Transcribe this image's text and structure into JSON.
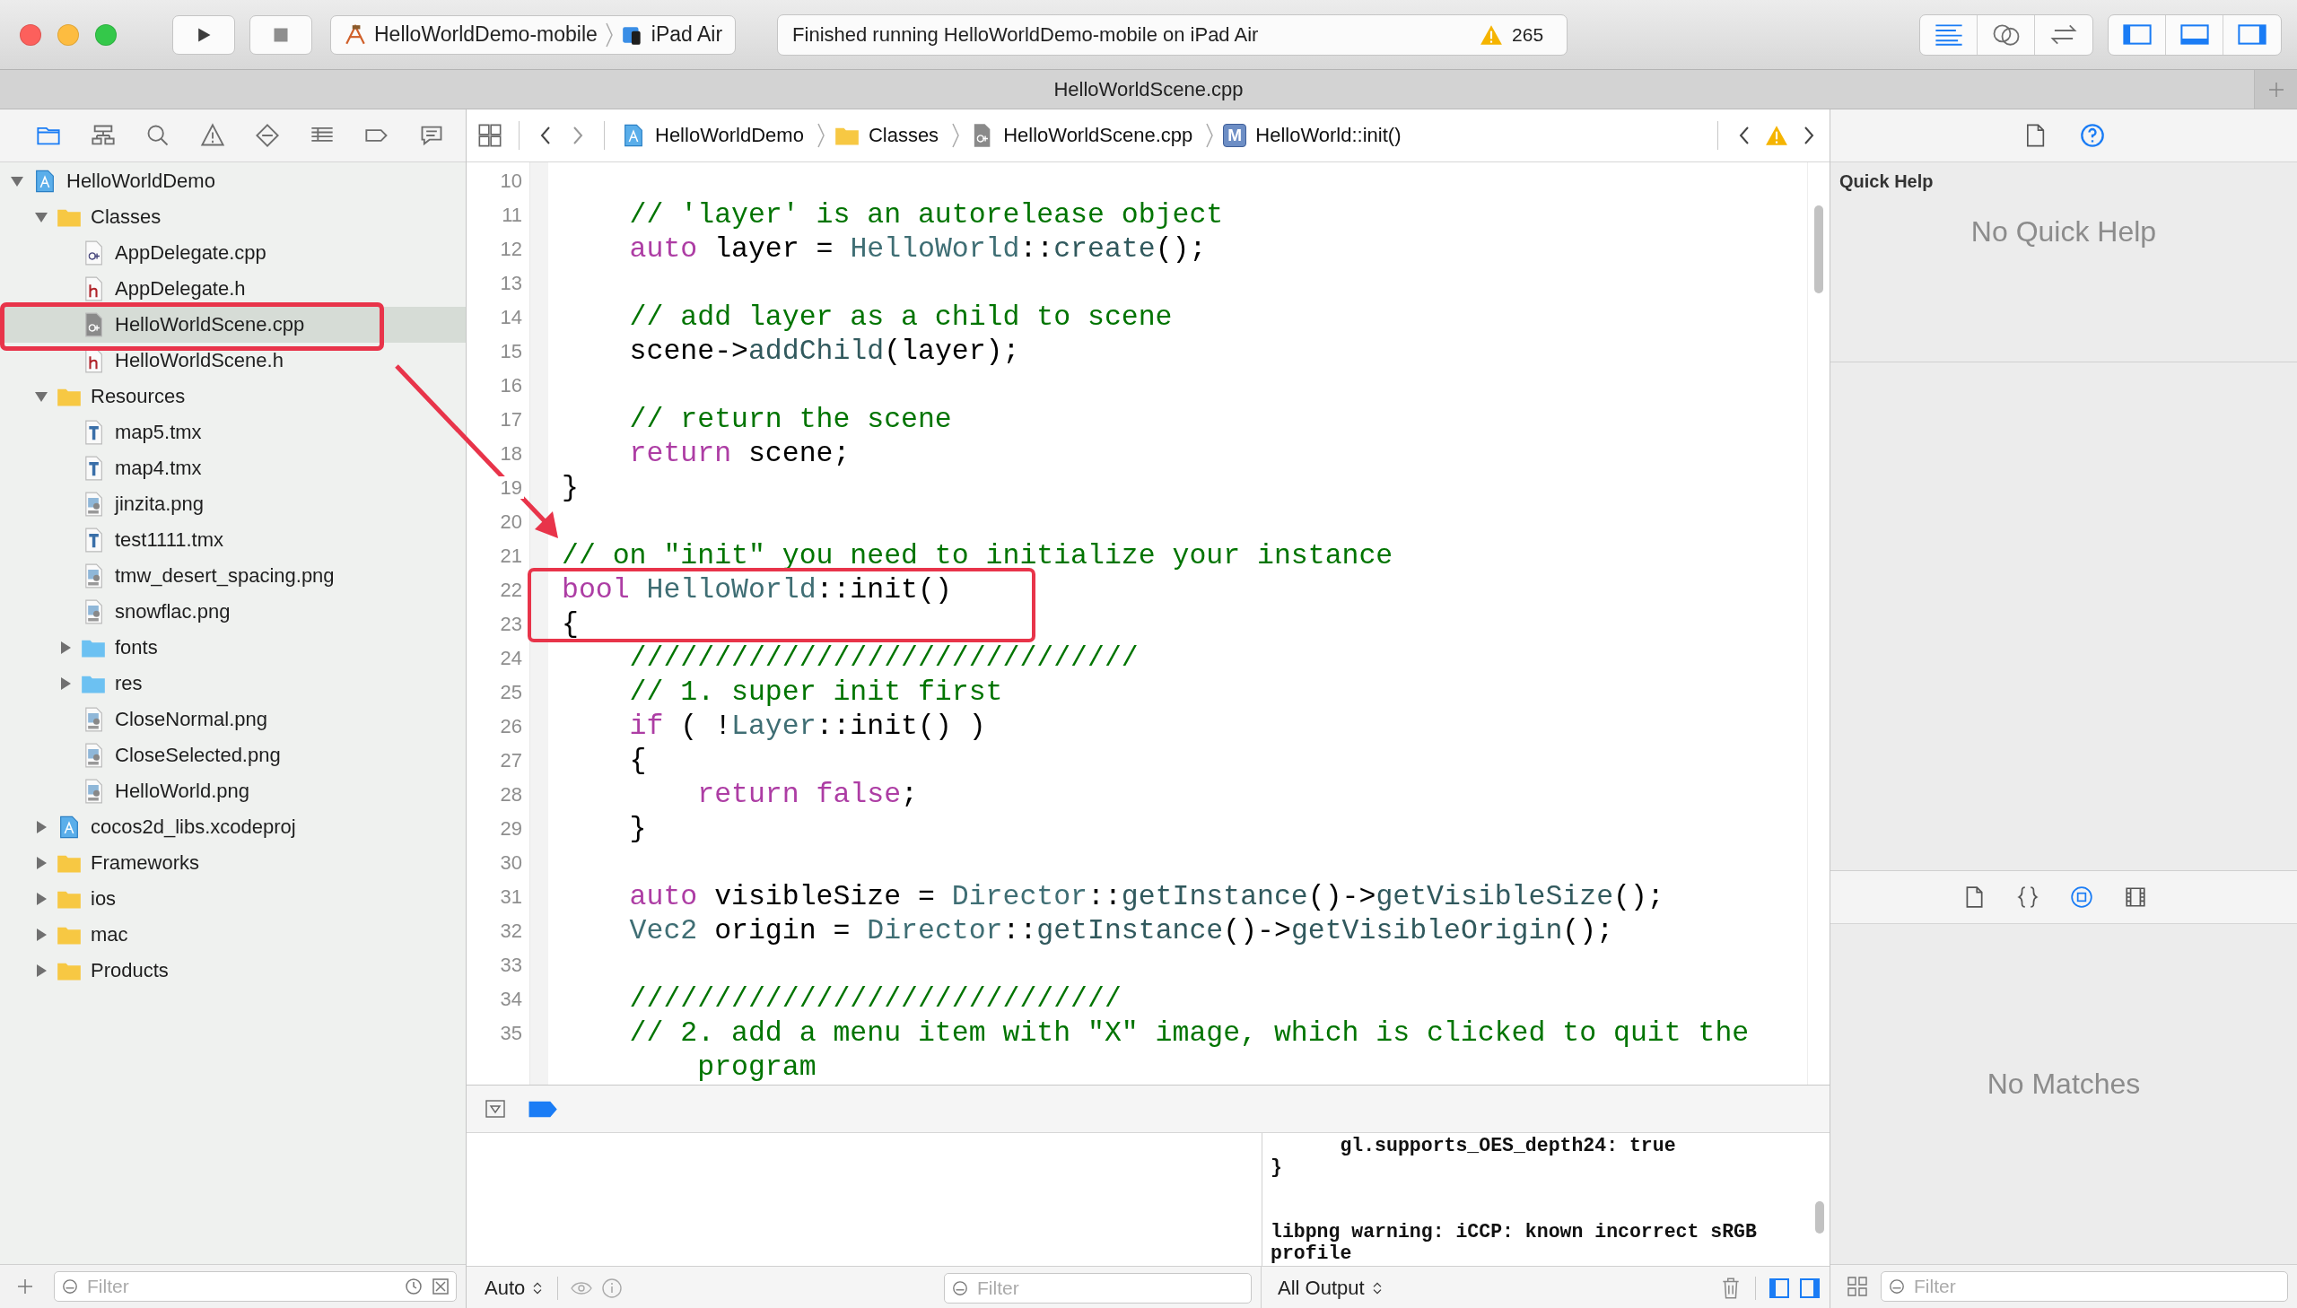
{
  "window": {
    "title": "HelloWorldScene.cpp"
  },
  "toolbar": {
    "scheme": "HelloWorldDemo-mobile",
    "device": "iPad Air",
    "status": "Finished running HelloWorldDemo-mobile on iPad Air",
    "warning_count": "265",
    "editor_modes": [
      {
        "kind": "standard",
        "selected": true
      },
      {
        "kind": "assistant",
        "selected": false
      },
      {
        "kind": "version",
        "selected": false
      }
    ],
    "panels": [
      {
        "kind": "navigator",
        "on": true
      },
      {
        "kind": "debug",
        "on": true
      },
      {
        "kind": "utilities",
        "on": true
      }
    ]
  },
  "navigator": {
    "tabs": [
      {
        "kind": "project",
        "selected": true
      },
      {
        "kind": "symbol",
        "selected": false
      },
      {
        "kind": "find",
        "selected": false
      },
      {
        "kind": "issue",
        "selected": false
      },
      {
        "kind": "test",
        "selected": false
      },
      {
        "kind": "debug",
        "selected": false
      },
      {
        "kind": "breakpoint",
        "selected": false
      },
      {
        "kind": "report",
        "selected": false
      }
    ],
    "tree": [
      {
        "name": "HelloWorldDemo",
        "kind": "project",
        "expanded": true,
        "selected": false,
        "children": [
          {
            "name": "Classes",
            "kind": "folder",
            "expanded": true,
            "selected": false,
            "children": [
              {
                "name": "AppDelegate.cpp",
                "kind": "cpp",
                "selected": false
              },
              {
                "name": "AppDelegate.h",
                "kind": "h",
                "selected": false
              },
              {
                "name": "HelloWorldScene.cpp",
                "kind": "cpp",
                "selected": true
              },
              {
                "name": "HelloWorldScene.h",
                "kind": "h",
                "selected": false
              }
            ]
          },
          {
            "name": "Resources",
            "kind": "folder",
            "expanded": true,
            "selected": false,
            "children": [
              {
                "name": "map5.tmx",
                "kind": "tmx",
                "selected": false
              },
              {
                "name": "map4.tmx",
                "kind": "tmx",
                "selected": false
              },
              {
                "name": "jinzita.png",
                "kind": "png",
                "selected": false
              },
              {
                "name": "test1111.tmx",
                "kind": "tmx",
                "selected": false
              },
              {
                "name": "tmw_desert_spacing.png",
                "kind": "png",
                "selected": false
              },
              {
                "name": "snowflac.png",
                "kind": "png",
                "selected": false
              },
              {
                "name": "fonts",
                "kind": "group",
                "expanded": false,
                "selected": false
              },
              {
                "name": "res",
                "kind": "group",
                "expanded": false,
                "selected": false
              },
              {
                "name": "CloseNormal.png",
                "kind": "png",
                "selected": false
              },
              {
                "name": "CloseSelected.png",
                "kind": "png",
                "selected": false
              },
              {
                "name": "HelloWorld.png",
                "kind": "png",
                "selected": false
              }
            ]
          },
          {
            "name": "cocos2d_libs.xcodeproj",
            "kind": "project",
            "expanded": false,
            "selected": false
          },
          {
            "name": "Frameworks",
            "kind": "folder",
            "expanded": false,
            "selected": false
          },
          {
            "name": "ios",
            "kind": "folder",
            "expanded": false,
            "selected": false
          },
          {
            "name": "mac",
            "kind": "folder",
            "expanded": false,
            "selected": false
          },
          {
            "name": "Products",
            "kind": "folder",
            "expanded": false,
            "selected": false
          }
        ]
      }
    ],
    "filter": {
      "placeholder": "Filter"
    }
  },
  "jump_bar": {
    "crumbs": [
      {
        "kind": "project",
        "label": "HelloWorldDemo"
      },
      {
        "kind": "folder",
        "label": "Classes"
      },
      {
        "kind": "cpp",
        "label": "HelloWorldScene.cpp"
      },
      {
        "kind": "method",
        "badge": "M",
        "label": "HelloWorld::init()"
      }
    ]
  },
  "editor": {
    "lines": [
      {
        "number": "10"
      },
      {
        "number": "11",
        "tokens": [
          {
            "kind": "comment",
            "text": "    // 'layer' is an autorelease object"
          }
        ]
      },
      {
        "number": "12",
        "tokens": [
          {
            "kind": "keyword",
            "text": "    auto"
          },
          {
            "kind": "plain",
            "text": " layer = "
          },
          {
            "kind": "type",
            "text": "HelloWorld"
          },
          {
            "kind": "plain",
            "text": "::"
          },
          {
            "kind": "function",
            "text": "create"
          },
          {
            "kind": "plain",
            "text": "();"
          }
        ]
      },
      {
        "number": "13"
      },
      {
        "number": "14",
        "tokens": [
          {
            "kind": "comment",
            "text": "    // add layer as a child to scene"
          }
        ]
      },
      {
        "number": "15",
        "tokens": [
          {
            "kind": "plain",
            "text": "    scene->"
          },
          {
            "kind": "function",
            "text": "addChild"
          },
          {
            "kind": "plain",
            "text": "(layer);"
          }
        ]
      },
      {
        "number": "16"
      },
      {
        "number": "17",
        "tokens": [
          {
            "kind": "comment",
            "text": "    // return the scene"
          }
        ]
      },
      {
        "number": "18",
        "tokens": [
          {
            "kind": "keyword",
            "text": "    return"
          },
          {
            "kind": "plain",
            "text": " scene;"
          }
        ]
      },
      {
        "number": "19",
        "tokens": [
          {
            "kind": "plain",
            "text": "}"
          }
        ]
      },
      {
        "number": "20"
      },
      {
        "number": "21",
        "tokens": [
          {
            "kind": "comment",
            "text": "// on \"init\" you need to initialize your instance"
          }
        ]
      },
      {
        "number": "22",
        "tokens": [
          {
            "kind": "keyword",
            "text": "bool"
          },
          {
            "kind": "type",
            "text": " HelloWorld"
          },
          {
            "kind": "plain",
            "text": "::init()"
          }
        ]
      },
      {
        "number": "23",
        "tokens": [
          {
            "kind": "plain",
            "text": "{"
          }
        ]
      },
      {
        "number": "24",
        "tokens": [
          {
            "kind": "comment",
            "text": "    //////////////////////////////"
          }
        ]
      },
      {
        "number": "25",
        "tokens": [
          {
            "kind": "comment",
            "text": "    // 1. super init first"
          }
        ]
      },
      {
        "number": "26",
        "tokens": [
          {
            "kind": "keyword",
            "text": "    if"
          },
          {
            "kind": "plain",
            "text": " ( !"
          },
          {
            "kind": "type",
            "text": "Layer"
          },
          {
            "kind": "plain",
            "text": "::init() )"
          }
        ]
      },
      {
        "number": "27",
        "tokens": [
          {
            "kind": "plain",
            "text": "    {"
          }
        ]
      },
      {
        "number": "28",
        "tokens": [
          {
            "kind": "keyword",
            "text": "        return false"
          },
          {
            "kind": "plain",
            "text": ";"
          }
        ]
      },
      {
        "number": "29",
        "tokens": [
          {
            "kind": "plain",
            "text": "    }"
          }
        ]
      },
      {
        "number": "30"
      },
      {
        "number": "31",
        "tokens": [
          {
            "kind": "keyword",
            "text": "    auto"
          },
          {
            "kind": "plain",
            "text": " visibleSize = "
          },
          {
            "kind": "type",
            "text": "Director"
          },
          {
            "kind": "plain",
            "text": "::"
          },
          {
            "kind": "function",
            "text": "getInstance"
          },
          {
            "kind": "plain",
            "text": "()->"
          },
          {
            "kind": "function",
            "text": "getVisibleSize"
          },
          {
            "kind": "plain",
            "text": "();"
          }
        ]
      },
      {
        "number": "32",
        "tokens": [
          {
            "kind": "type",
            "text": "    Vec2"
          },
          {
            "kind": "plain",
            "text": " origin = "
          },
          {
            "kind": "type",
            "text": "Director"
          },
          {
            "kind": "plain",
            "text": "::"
          },
          {
            "kind": "function",
            "text": "getInstance"
          },
          {
            "kind": "plain",
            "text": "()->"
          },
          {
            "kind": "function",
            "text": "getVisibleOrigin"
          },
          {
            "kind": "plain",
            "text": "();"
          }
        ]
      },
      {
        "number": "33"
      },
      {
        "number": "34",
        "tokens": [
          {
            "kind": "comment",
            "text": "    /////////////////////////////"
          }
        ]
      },
      {
        "number": "35",
        "tokens": [
          {
            "kind": "comment",
            "text": "    // 2. add a menu item with \"X\" image, which is clicked to quit the"
          }
        ]
      },
      {
        "tokens": [
          {
            "kind": "comment",
            "text": "        program"
          }
        ]
      }
    ]
  },
  "debug": {
    "breakpoints_active": true,
    "scope": "Auto",
    "filter": {
      "placeholder": "Filter"
    },
    "console": "      gl.supports_OES_depth24: true\n}\n\n\nlibpng warning: iCCP: known incorrect sRGB\nprofile",
    "output": "All Output",
    "panes": [
      {
        "kind": "variables",
        "on": true
      },
      {
        "kind": "console",
        "on": true
      }
    ]
  },
  "inspector": {
    "tabs": [
      {
        "kind": "file",
        "selected": false
      },
      {
        "kind": "help",
        "selected": true
      }
    ],
    "heading": "Quick Help",
    "empty": "No Quick Help",
    "library_tabs": [
      {
        "kind": "file",
        "selected": false
      },
      {
        "kind": "snippet",
        "selected": false
      },
      {
        "kind": "object",
        "selected": true
      },
      {
        "kind": "media",
        "selected": false
      }
    ],
    "library_empty": "No Matches",
    "filter": {
      "placeholder": "Filter"
    }
  }
}
